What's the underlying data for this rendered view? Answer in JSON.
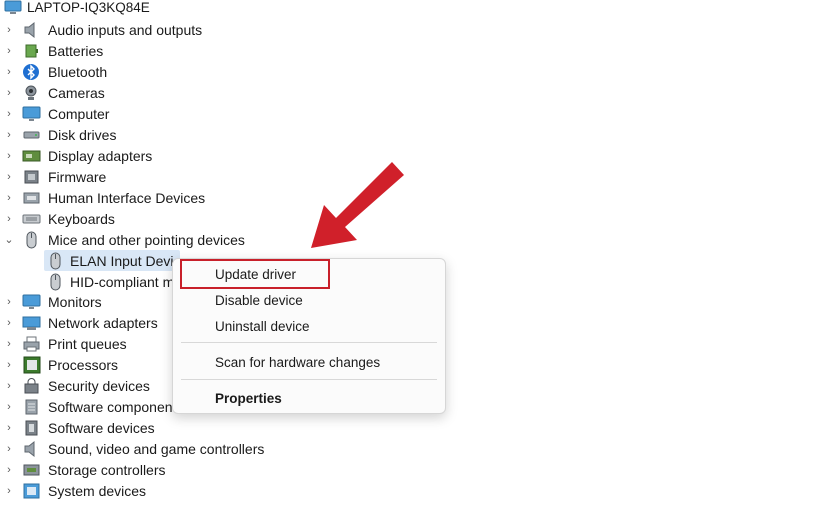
{
  "root": {
    "label": "LAPTOP-IQ3KQ84E",
    "icon": "computer-icon"
  },
  "tree": [
    {
      "label": "Audio inputs and outputs",
      "icon": "speaker-icon",
      "expanded": false
    },
    {
      "label": "Batteries",
      "icon": "battery-icon",
      "expanded": false
    },
    {
      "label": "Bluetooth",
      "icon": "bluetooth-icon",
      "expanded": false
    },
    {
      "label": "Cameras",
      "icon": "camera-icon",
      "expanded": false
    },
    {
      "label": "Computer",
      "icon": "monitor-icon",
      "expanded": false
    },
    {
      "label": "Disk drives",
      "icon": "disk-drive-icon",
      "expanded": false
    },
    {
      "label": "Display adapters",
      "icon": "display-adapter-icon",
      "expanded": false
    },
    {
      "label": "Firmware",
      "icon": "firmware-icon",
      "expanded": false
    },
    {
      "label": "Human Interface Devices",
      "icon": "hid-icon",
      "expanded": false
    },
    {
      "label": "Keyboards",
      "icon": "keyboard-icon",
      "expanded": false
    },
    {
      "label": "Mice and other pointing devices",
      "icon": "mouse-icon",
      "expanded": true
    },
    {
      "label": "ELAN Input Device",
      "icon": "mouse-icon",
      "child": true,
      "selected": true
    },
    {
      "label": "HID-compliant mouse",
      "icon": "mouse-icon",
      "child": true
    },
    {
      "label": "Monitors",
      "icon": "monitor-icon",
      "expanded": false
    },
    {
      "label": "Network adapters",
      "icon": "network-adapter-icon",
      "expanded": false
    },
    {
      "label": "Print queues",
      "icon": "printer-icon",
      "expanded": false
    },
    {
      "label": "Processors",
      "icon": "processor-icon",
      "expanded": false
    },
    {
      "label": "Security devices",
      "icon": "security-device-icon",
      "expanded": false
    },
    {
      "label": "Software components",
      "icon": "software-component-icon",
      "expanded": false
    },
    {
      "label": "Software devices",
      "icon": "software-device-icon",
      "expanded": false
    },
    {
      "label": "Sound, video and game controllers",
      "icon": "speaker-icon",
      "expanded": false
    },
    {
      "label": "Storage controllers",
      "icon": "storage-controller-icon",
      "expanded": false
    },
    {
      "label": "System devices",
      "icon": "system-device-icon",
      "expanded": false
    }
  ],
  "context_menu": {
    "items": [
      {
        "label": "Update driver",
        "highlighted": true
      },
      {
        "label": "Disable device"
      },
      {
        "label": "Uninstall device"
      },
      {
        "label": "Scan for hardware changes"
      },
      {
        "label": "Properties",
        "bold": true
      }
    ]
  },
  "colors": {
    "annotation_red": "#d0202a",
    "selection": "#d9e7f6"
  }
}
